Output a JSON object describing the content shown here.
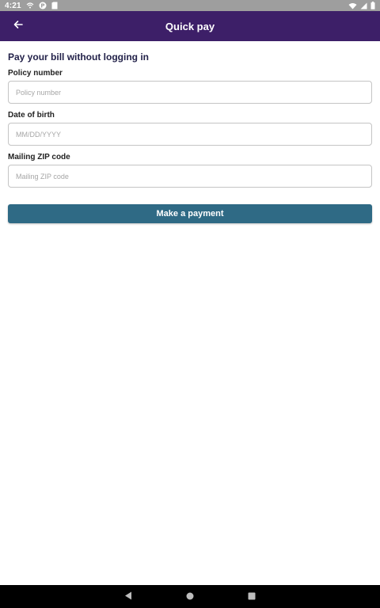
{
  "status_bar": {
    "time": "4:21",
    "icons": [
      "wifi-assist-icon",
      "podcast-icon",
      "sim-card-icon",
      "wifi-icon",
      "signal-icon",
      "battery-icon"
    ]
  },
  "app_bar": {
    "title": "Quick pay",
    "back_icon": "arrow-left-icon"
  },
  "form": {
    "heading": "Pay your bill without logging in",
    "policy_number": {
      "label": "Policy number",
      "value": "",
      "placeholder": "Policy number"
    },
    "date_of_birth": {
      "label": "Date of birth",
      "value": "",
      "placeholder": "MM/DD/YYYY"
    },
    "zip_code": {
      "label": "Mailing ZIP code",
      "value": "",
      "placeholder": "Mailing ZIP code"
    },
    "submit_label": "Make a payment"
  },
  "nav_bar": {
    "icons": [
      "back-triangle-icon",
      "home-circle-icon",
      "recents-square-icon"
    ]
  },
  "colors": {
    "app_bar": "#3d1f68",
    "button": "#2f6a85",
    "heading_text": "#23224a",
    "status_bar": "#9e9e9e"
  }
}
